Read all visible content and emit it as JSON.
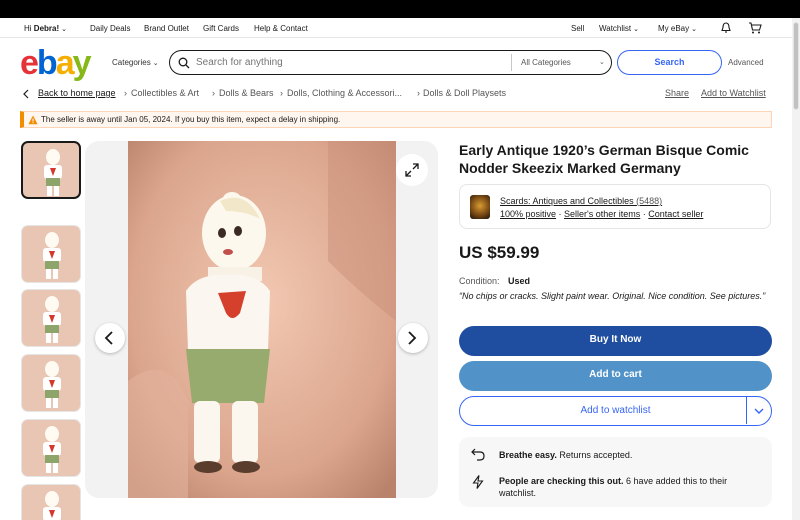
{
  "topbar": {
    "greeting": "Hi",
    "user": "Debra!",
    "links": [
      "Daily Deals",
      "Brand Outlet",
      "Gift Cards",
      "Help & Contact"
    ],
    "right": [
      "Sell",
      "Watchlist",
      "My eBay"
    ]
  },
  "header": {
    "logo": [
      "e",
      "b",
      "a",
      "y"
    ],
    "categories": "Categories",
    "search_placeholder": "Search for anything",
    "category_select": "All Categories",
    "search_button": "Search",
    "advanced": "Advanced"
  },
  "breadcrumb": {
    "back": "Back to home page",
    "items": [
      "Collectibles & Art",
      "Dolls & Bears",
      "Dolls, Clothing & Accessori...",
      "Dolls & Doll Playsets"
    ],
    "share": "Share",
    "add_watchlist": "Add to Watchlist"
  },
  "banner": {
    "message": "The seller is away until Jan 05, 2024. If you buy this item, expect a delay in shipping."
  },
  "listing": {
    "title": "Early Antique 1920’s German Bisque Comic Nodder Skeezix Marked Germany",
    "seller_name": "Scards: Antiques and Collectibles",
    "seller_count": "(5488)",
    "seller_positive": "100% positive",
    "seller_items": "Seller's other items",
    "contact": "Contact seller",
    "price": "US $59.99",
    "condition_label": "Condition:",
    "condition_value": "Used",
    "condition_note": "“No chips or cracks. Slight paint wear. Original. Nice condition. See pictures.”",
    "buy_now": "Buy It Now",
    "add_cart": "Add to cart",
    "add_watch": "Add to watchlist",
    "info1_bold": "Breathe easy.",
    "info1_text": " Returns accepted.",
    "info2_bold": "People are checking this out.",
    "info2_text": " 6 have added this to their watchlist."
  },
  "colors": {
    "accent": "#3665f3",
    "buy_button": "#1f4ea1",
    "cart_button": "#5193c9",
    "banner_border": "#f18e00"
  },
  "icons": [
    "chevron-left-icon",
    "bell-icon",
    "cart-icon",
    "search-icon",
    "warning-icon",
    "expand-icon",
    "chevron-right-icon",
    "returns-icon",
    "lightning-icon",
    "chevron-down-icon"
  ]
}
